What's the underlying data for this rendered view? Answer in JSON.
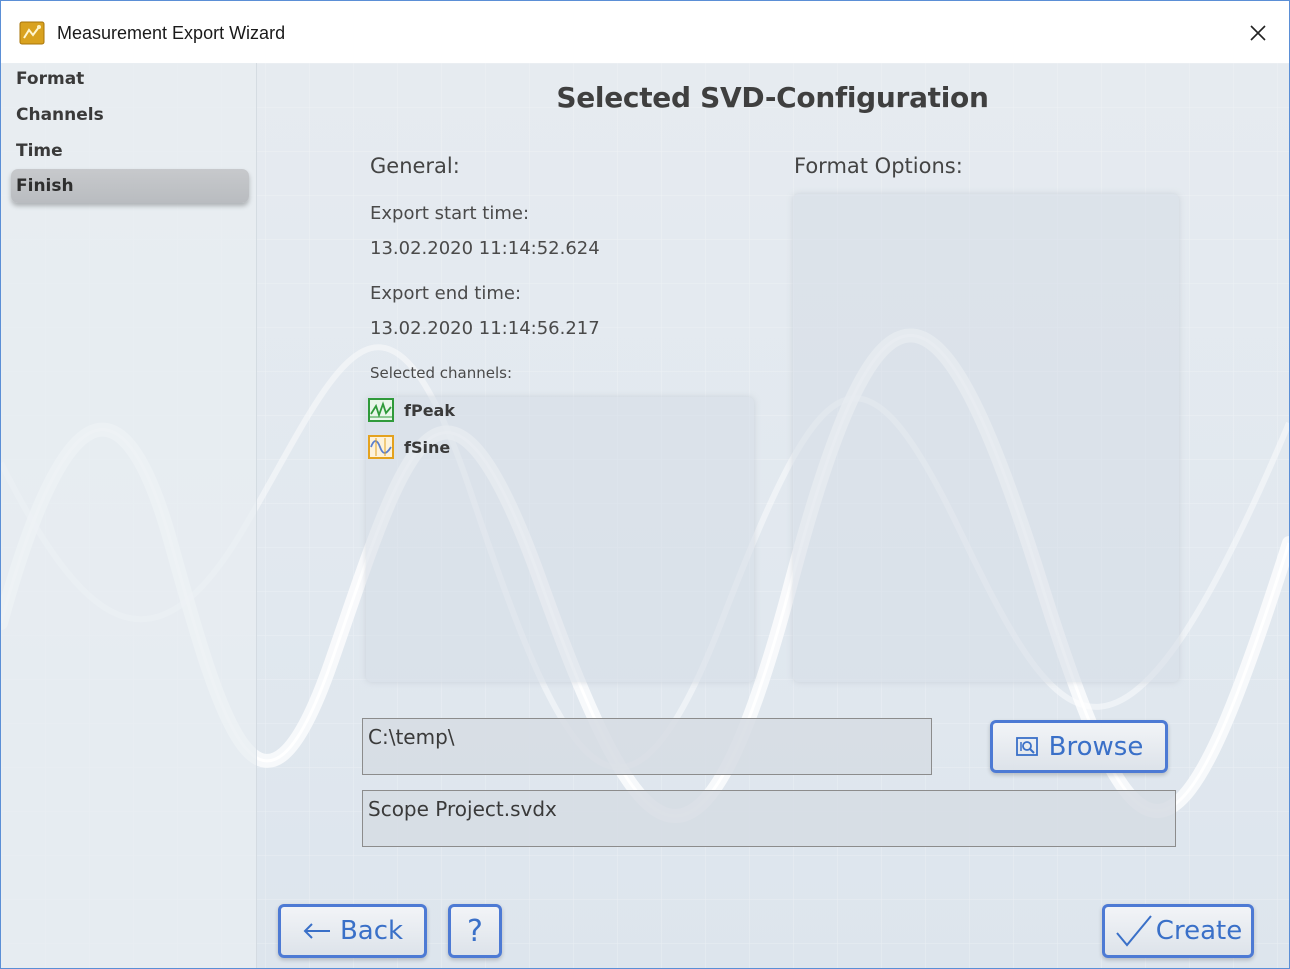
{
  "window": {
    "title": "Measurement Export Wizard",
    "close_symbol": "✕"
  },
  "sidebar": {
    "items": [
      {
        "label": "Format",
        "active": false
      },
      {
        "label": "Channels",
        "active": false
      },
      {
        "label": "Time",
        "active": false
      },
      {
        "label": "Finish",
        "active": true
      }
    ]
  },
  "main": {
    "heading": "Selected SVD-Configuration",
    "general": {
      "label": "General:",
      "start_label": "Export start time:",
      "start_value": "13.02.2020 11:14:52.624",
      "end_label": "Export end time:",
      "end_value": "13.02.2020 11:14:56.217",
      "channels_label": "Selected channels:",
      "channels": [
        {
          "name": "fPeak",
          "icon": "peak-channel-icon",
          "color": "#2f9a3a"
        },
        {
          "name": "fSine",
          "icon": "sine-channel-icon",
          "color": "#e4a21e"
        }
      ]
    },
    "format_options": {
      "label": "Format Options:"
    },
    "path_field": {
      "value": "C:\\temp\\"
    },
    "filename_field": {
      "value": "Scope Project.svdx"
    },
    "browse_label": "Browse"
  },
  "footer": {
    "back_label": "Back",
    "help_label": "?",
    "create_label": "Create"
  },
  "colors": {
    "accent": "#4d7ad4",
    "button_text": "#3a70c8",
    "window_border": "#5b8fd6"
  }
}
